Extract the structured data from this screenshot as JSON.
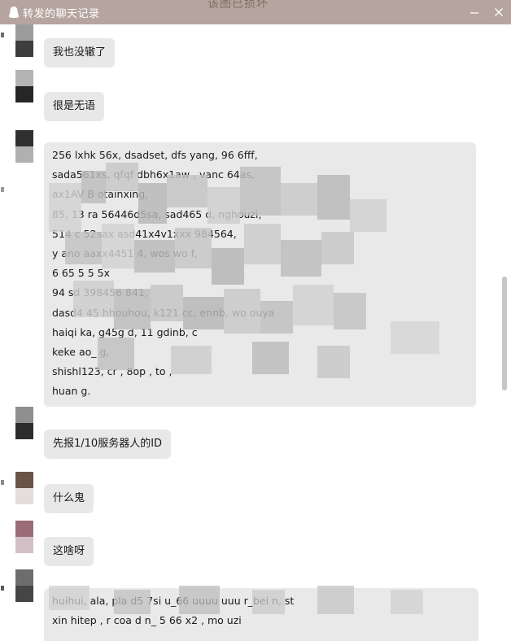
{
  "window": {
    "title": "转发的聊天记录",
    "faded_header": "该图已损坏",
    "minimize_label": "—",
    "close_label": "✕"
  },
  "messages": [
    {
      "text": "我也没辙了"
    },
    {
      "text": "很是无语"
    },
    {
      "lines": [
        "                    256 lxhk    56x, dsadset, dfs       yang, 96     6fff,",
        "sada561xs, qfqf         dbh6x1aw             ,       vanc      64as,",
        "               ax1AV B                                     otainxing,",
        "            85,  13    ra 56446d5sa, sad465      d,             nghouzi,",
        "           514          c    52sax       asd41x4v1xxx               984564,",
        "            y ano                       aaxx4451                4, wos  wo  f,",
        "     6                                                    65 5 5    5x",
        "   94                                 sd           398456              841,",
        "dasd4    45         hhouhou,        k121    cc,     ennb, wo       ouya",
        "haiqi             ka, g45g    d,  11                   gdinb,        c",
        "keke                                                                     ao_   g,",
        "shishl123, cr                                              , 8op      , to    ,",
        "huan      g."
      ]
    },
    {
      "text": "先报1/10服务器人的ID"
    },
    {
      "text": "什么鬼"
    },
    {
      "text": "这啥呀"
    },
    {
      "lines": [
        "       huihui,     ala, pla     d5    7si    u_66    uuuu    uuu     r_bei    n, st    ",
        "xin         hitep       ,  r     coa      d     n_   5  66      x2    , mo     uzi"
      ]
    }
  ],
  "colors": {
    "titlebar": "#b5a59e",
    "bubble": "#e8e8e8",
    "scroll_thumb": "#c6c6c6"
  }
}
